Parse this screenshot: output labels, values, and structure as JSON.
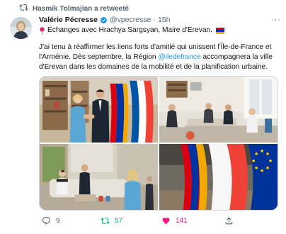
{
  "retweet": {
    "text": "Hasmik Tolmajian a retweeté",
    "icon": "retweet-icon"
  },
  "tweet": {
    "author_name": "Valérie Pécresse",
    "handle": "@vpecresse",
    "separator": "·",
    "time": "15h",
    "more_icon": "more-icon",
    "verified_icon": "verified-badge-icon",
    "line1": "Échanges avec Hrachya Sargsyan, Maire d'Erevan.",
    "line1_icons": [
      "pin-icon",
      "armenia-flag-icon"
    ],
    "body_before_mention": "J'ai tenu à réaffirmer les liens forts d'amitié qui unissent l'Île-de-France et l'Arménie. Dès septembre, la Région ",
    "mention": "@iledefrance",
    "body_after_mention": " accompagnera la ville d'Erevan dans les domaines de la mobilité et de la planification urbaine.",
    "photos": [
      {
        "name": "photo-handshake"
      },
      {
        "name": "photo-meeting-room"
      },
      {
        "name": "photo-sofa-discussion"
      },
      {
        "name": "photo-flags"
      }
    ]
  },
  "actions": {
    "reply": {
      "count": "9",
      "icon": "reply-icon"
    },
    "retweet": {
      "count": "57",
      "icon": "retweet-icon"
    },
    "like": {
      "count": "141",
      "icon": "heart-icon"
    },
    "share": {
      "icon": "share-icon"
    }
  },
  "colors": {
    "accent": "#1d9bf0",
    "retweet_active": "#00ba7c",
    "like_active": "#f91880",
    "muted": "#536471"
  }
}
